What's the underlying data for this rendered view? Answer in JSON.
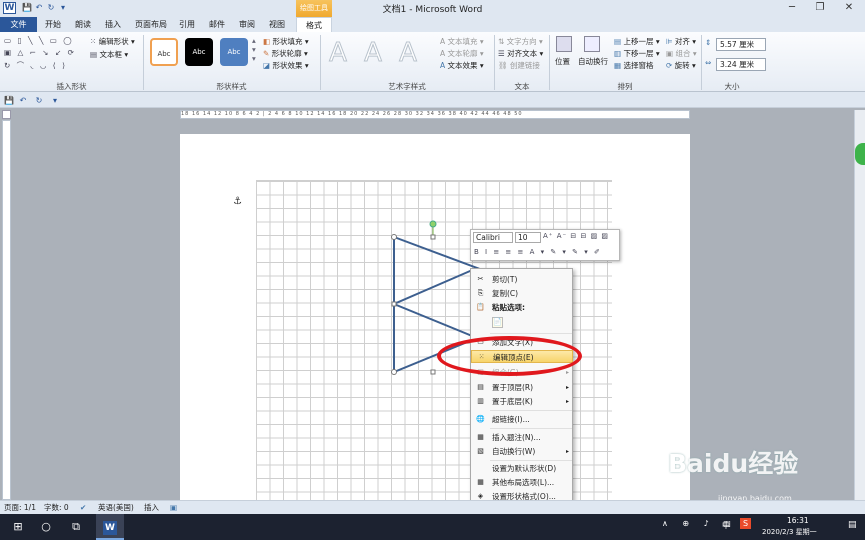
{
  "window": {
    "title": "文档1 - Microsoft Word",
    "context_tab_label": "绘图工具",
    "min": "─",
    "max": "❐",
    "close": "✕"
  },
  "qat": {
    "save": "💾",
    "undo": "↶",
    "redo": "↻",
    "customize": "▾"
  },
  "tabs": [
    "文件",
    "开始",
    "朗读",
    "插入",
    "页面布局",
    "引用",
    "邮件",
    "审阅",
    "视图",
    "格式"
  ],
  "active_tab": "格式",
  "ribbon": {
    "insert_shapes": {
      "label": "插入形状",
      "edit_shape": "编辑形状 ▾",
      "text_box": "文本框 ▾",
      "shapes_row1": "▭ ▯ ╲ ╲ ▭ ◯",
      "shapes_row2": "▣ △ ⌐ ↘ ↙ ⟳",
      "shapes_row3": "↻ ⌒ ◟ ◡ ⟨ ⟩"
    },
    "shape_styles": {
      "label": "形状样式",
      "swatches": [
        "Abc",
        "Abc",
        "Abc"
      ],
      "fill": "形状填充 ▾",
      "outline": "形状轮廓 ▾",
      "effects": "形状效果 ▾"
    },
    "wordart": {
      "label": "艺术字样式",
      "letters": [
        "A",
        "A",
        "A"
      ],
      "text_fill": "文本填充 ▾",
      "text_outline": "文本轮廓 ▾",
      "text_effects": "文本效果 ▾"
    },
    "text": {
      "label": "文本",
      "direction": "文字方向 ▾",
      "align": "对齐文本 ▾",
      "link": "创建链接"
    },
    "arrange": {
      "label": "排列",
      "position": "位置",
      "wrap": "自动换行",
      "bring_forward": "上移一层 ▾",
      "send_backward": "下移一层 ▾",
      "selection_pane": "选择窗格",
      "align": "对齐 ▾",
      "group": "组合 ▾",
      "rotate": "旋转 ▾"
    },
    "size": {
      "label": "大小",
      "height": "5.57 厘米",
      "width": "3.24 厘米"
    }
  },
  "ruler": {
    "h_ticks": "18 16 14 12 10 8 6 4 2 | 2 4 6 8 10 12 14 16 18 20 22 24 26 28 30 32 34 36 38 40 42 44 46 48 50"
  },
  "mini_toolbar": {
    "font": "Calibri",
    "size": "10",
    "row1_icons": "A⁺ A⁻ ⊟ ⊟ ▨ ▨",
    "row2_icons": "B I ≡ ≡ ≡ A ▾ ✎ ▾ ✎ ▾ ✐"
  },
  "context_menu": [
    {
      "label": "剪切(T)",
      "icon": "✂"
    },
    {
      "label": "复制(C)",
      "icon": "⎘"
    },
    {
      "label": "粘贴选项:",
      "icon": "📋"
    },
    {
      "label": "",
      "icon": "📄"
    },
    {
      "label": "添加文字(X)",
      "icon": "▭"
    },
    {
      "label": "编辑顶点(E)",
      "icon": "⁙"
    },
    {
      "label": "组合(G)",
      "icon": "▣",
      "arrow": "▸"
    },
    {
      "label": "置于顶层(R)",
      "icon": "▤",
      "arrow": "▸"
    },
    {
      "label": "置于底层(K)",
      "icon": "▥",
      "arrow": "▸"
    },
    {
      "label": "超链接(I)...",
      "icon": "🌐"
    },
    {
      "label": "插入题注(N)...",
      "icon": "▦"
    },
    {
      "label": "自动换行(W)",
      "icon": "▧",
      "arrow": "▸"
    },
    {
      "label": "设置为默认形状(D)",
      "icon": ""
    },
    {
      "label": "其他布局选项(L)...",
      "icon": "▦"
    },
    {
      "label": "设置形状格式(O)...",
      "icon": "◈"
    }
  ],
  "status": {
    "page": "页面: 1/1",
    "words": "字数: 0",
    "lang": "英语(美国)",
    "mode": "插入"
  },
  "taskbar": {
    "time": "16:31",
    "date": "2020/2/3 星期一",
    "ime": "中",
    "start": "⊞",
    "search": "○",
    "taskview": "⧉",
    "word": "W"
  },
  "watermark": {
    "brand": "Baidu经验",
    "url": "jingyan.baidu.com"
  }
}
